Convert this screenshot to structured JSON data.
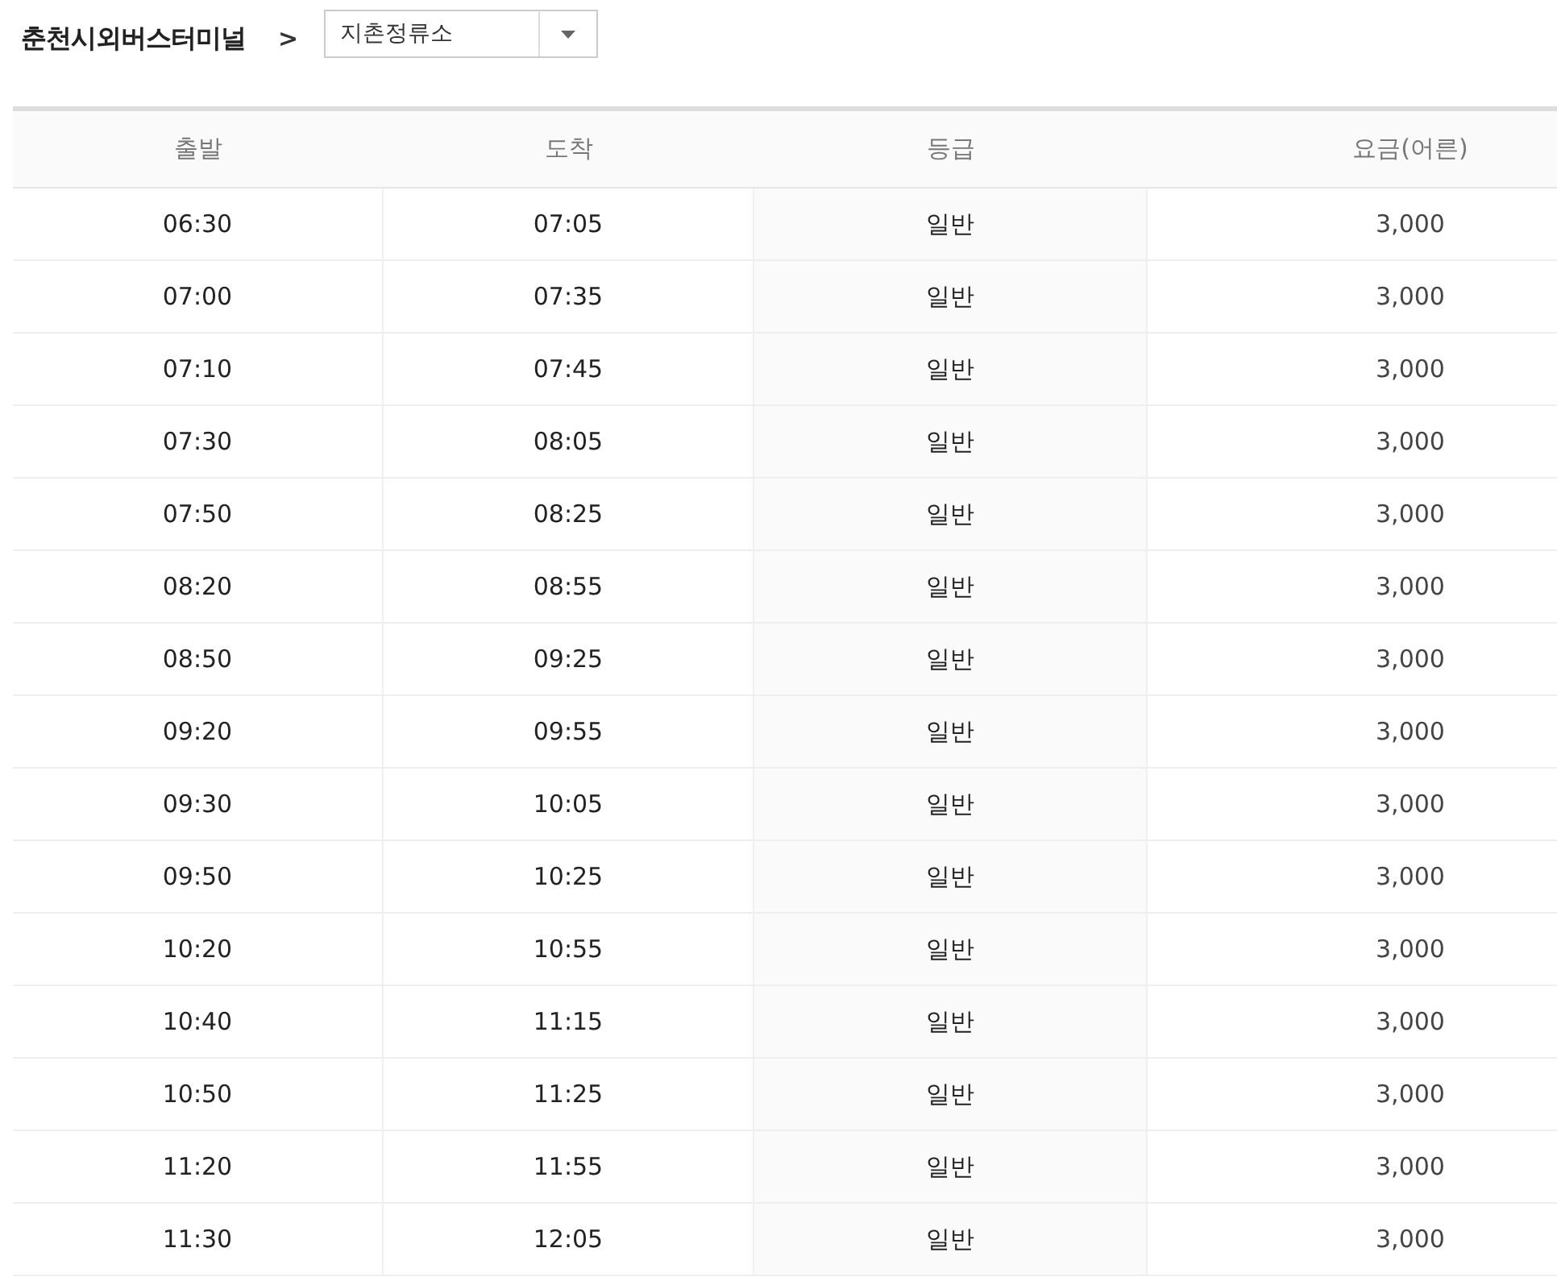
{
  "breadcrumb": {
    "origin": "춘천시외버스터미널",
    "separator": ">",
    "destination": {
      "value": "지촌정류소"
    }
  },
  "table": {
    "columns": [
      "출발",
      "도착",
      "등급",
      "요금(어른)"
    ],
    "rows": [
      [
        "06:30",
        "07:05",
        "일반",
        "3,000"
      ],
      [
        "07:00",
        "07:35",
        "일반",
        "3,000"
      ],
      [
        "07:10",
        "07:45",
        "일반",
        "3,000"
      ],
      [
        "07:30",
        "08:05",
        "일반",
        "3,000"
      ],
      [
        "07:50",
        "08:25",
        "일반",
        "3,000"
      ],
      [
        "08:20",
        "08:55",
        "일반",
        "3,000"
      ],
      [
        "08:50",
        "09:25",
        "일반",
        "3,000"
      ],
      [
        "09:20",
        "09:55",
        "일반",
        "3,000"
      ],
      [
        "09:30",
        "10:05",
        "일반",
        "3,000"
      ],
      [
        "09:50",
        "10:25",
        "일반",
        "3,000"
      ],
      [
        "10:20",
        "10:55",
        "일반",
        "3,000"
      ],
      [
        "10:40",
        "11:15",
        "일반",
        "3,000"
      ],
      [
        "10:50",
        "11:25",
        "일반",
        "3,000"
      ],
      [
        "11:20",
        "11:55",
        "일반",
        "3,000"
      ],
      [
        "11:30",
        "12:05",
        "일반",
        "3,000"
      ]
    ]
  }
}
